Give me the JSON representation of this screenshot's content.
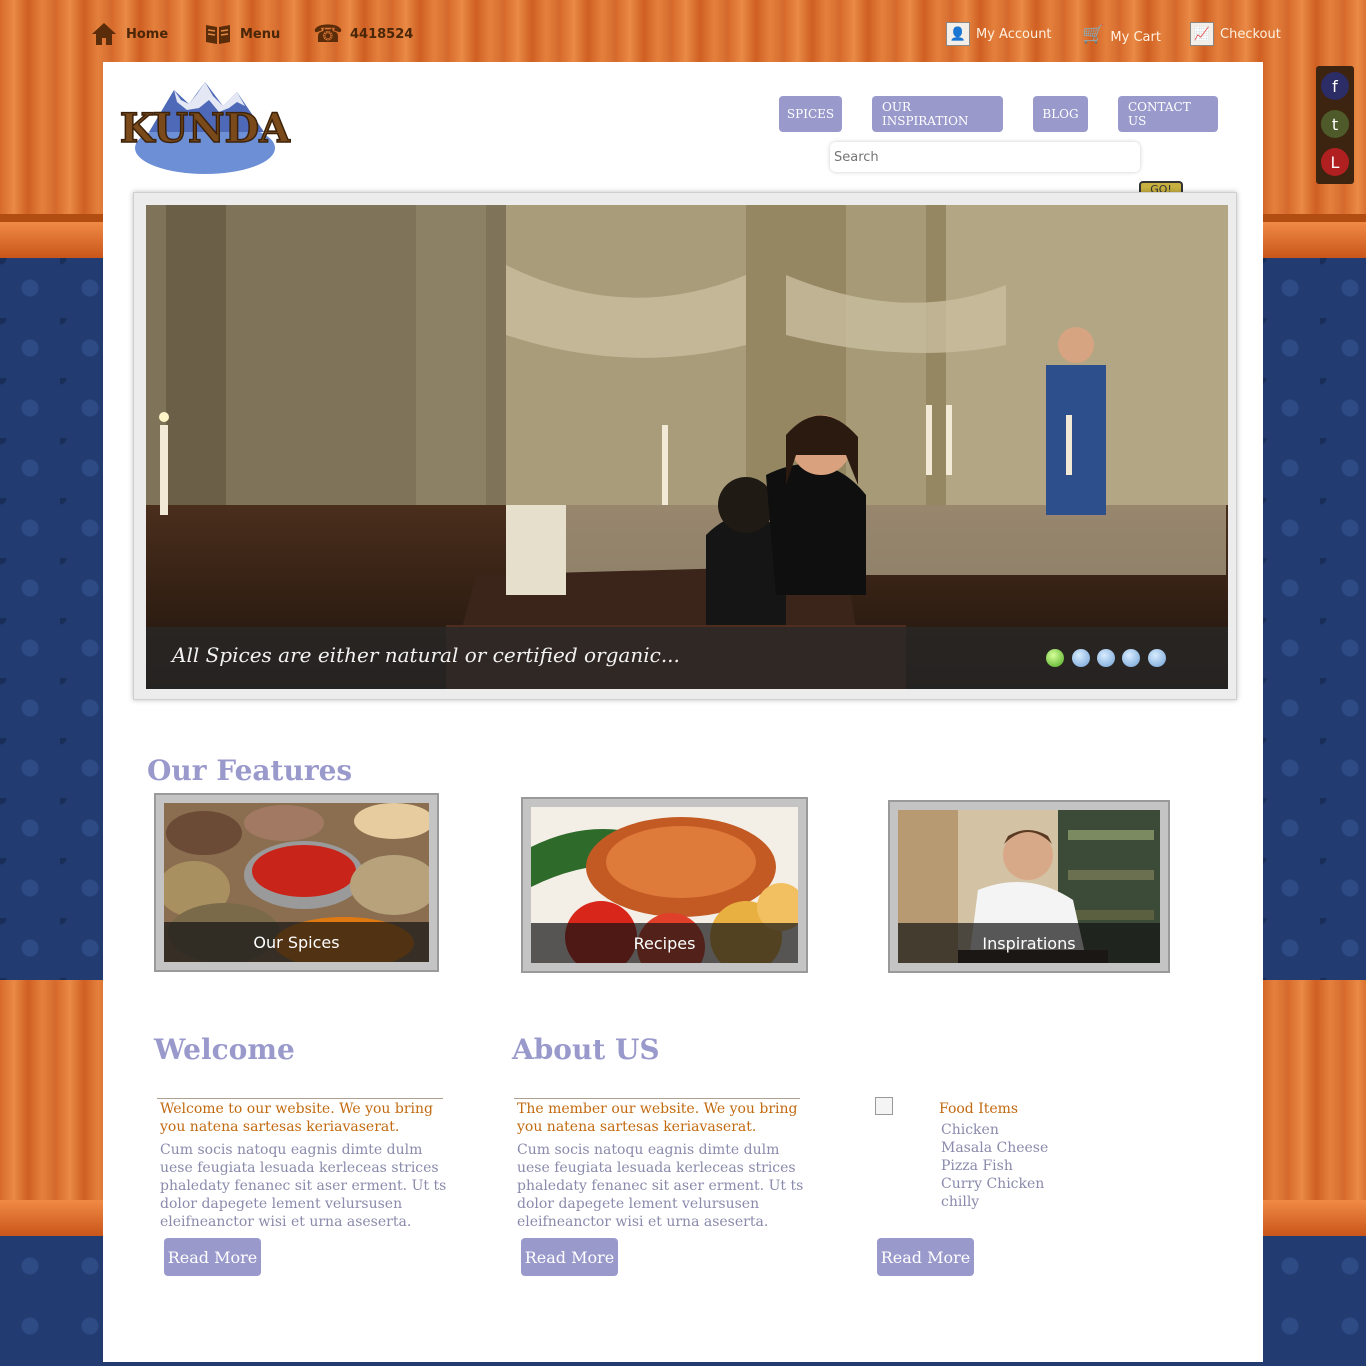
{
  "topbar": {
    "home": "Home",
    "menu": "Menu",
    "phone": "4418524",
    "my_account": "My Account",
    "my_cart": "My Cart",
    "checkout": "Checkout"
  },
  "social": {
    "facebook": "f",
    "twitter": "t",
    "linkedin": "L"
  },
  "logo": {
    "text": "KUNDA"
  },
  "nav": {
    "items": [
      "SPICES",
      "OUR INSPIRATION",
      "BLOG",
      "CONTACT US"
    ]
  },
  "search": {
    "placeholder": "Search",
    "go_label": "GO!"
  },
  "slider": {
    "caption": "All Spices are either natural or certified organic...",
    "active_index": 0,
    "dot_count": 5
  },
  "features": {
    "title": "Our Features",
    "items": [
      "Our Spices",
      "Recipes",
      "Inspirations"
    ]
  },
  "welcome": {
    "title": "Welcome",
    "lead": "Welcome to our website. We you bring you natena sartesas keriavaserat.",
    "body": "Cum socis natoqu eagnis dimte dulm uese feugiata lesuada kerleceas strices phaledaty fenanec sit aser erment. Ut ts dolor dapegete lement velursusen eleifneanctor wisi et urna aseserta.",
    "read_more": "Read More"
  },
  "about": {
    "title": "About US",
    "lead": "The member our website. We you bring you natena sartesas keriavaserat.",
    "body": "Cum socis natoqu eagnis dimte dulm uese feugiata lesuada kerleceas strices phaledaty fenanec sit aser erment. Ut ts dolor dapegete lement velursusen eleifneanctor wisi et urna aseserta.",
    "read_more": "Read More"
  },
  "food": {
    "title": "Food Items",
    "items": [
      "Chicken",
      "Masala Cheese",
      "Pizza Fish",
      "Curry Chicken",
      "chilly"
    ],
    "read_more": "Read More"
  },
  "colors": {
    "accent": "#9999cc",
    "lead_text": "#c26a10",
    "body_text": "#8a8aac"
  }
}
